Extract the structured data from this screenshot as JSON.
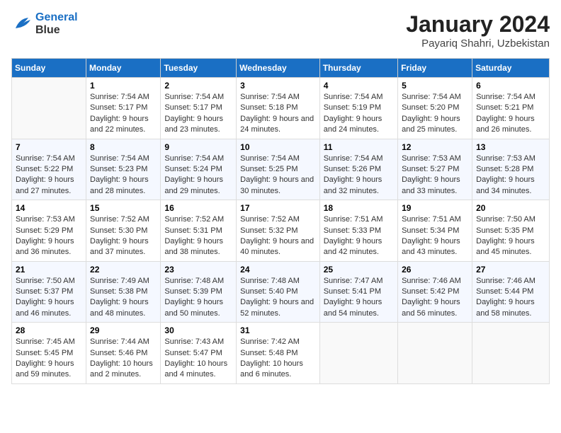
{
  "header": {
    "logo_line1": "General",
    "logo_line2": "Blue",
    "month": "January 2024",
    "location": "Payariq Shahri, Uzbekistan"
  },
  "days_of_week": [
    "Sunday",
    "Monday",
    "Tuesday",
    "Wednesday",
    "Thursday",
    "Friday",
    "Saturday"
  ],
  "weeks": [
    [
      {
        "num": "",
        "sunrise": "",
        "sunset": "",
        "daylight": ""
      },
      {
        "num": "1",
        "sunrise": "Sunrise: 7:54 AM",
        "sunset": "Sunset: 5:17 PM",
        "daylight": "Daylight: 9 hours and 22 minutes."
      },
      {
        "num": "2",
        "sunrise": "Sunrise: 7:54 AM",
        "sunset": "Sunset: 5:17 PM",
        "daylight": "Daylight: 9 hours and 23 minutes."
      },
      {
        "num": "3",
        "sunrise": "Sunrise: 7:54 AM",
        "sunset": "Sunset: 5:18 PM",
        "daylight": "Daylight: 9 hours and 24 minutes."
      },
      {
        "num": "4",
        "sunrise": "Sunrise: 7:54 AM",
        "sunset": "Sunset: 5:19 PM",
        "daylight": "Daylight: 9 hours and 24 minutes."
      },
      {
        "num": "5",
        "sunrise": "Sunrise: 7:54 AM",
        "sunset": "Sunset: 5:20 PM",
        "daylight": "Daylight: 9 hours and 25 minutes."
      },
      {
        "num": "6",
        "sunrise": "Sunrise: 7:54 AM",
        "sunset": "Sunset: 5:21 PM",
        "daylight": "Daylight: 9 hours and 26 minutes."
      }
    ],
    [
      {
        "num": "7",
        "sunrise": "Sunrise: 7:54 AM",
        "sunset": "Sunset: 5:22 PM",
        "daylight": "Daylight: 9 hours and 27 minutes."
      },
      {
        "num": "8",
        "sunrise": "Sunrise: 7:54 AM",
        "sunset": "Sunset: 5:23 PM",
        "daylight": "Daylight: 9 hours and 28 minutes."
      },
      {
        "num": "9",
        "sunrise": "Sunrise: 7:54 AM",
        "sunset": "Sunset: 5:24 PM",
        "daylight": "Daylight: 9 hours and 29 minutes."
      },
      {
        "num": "10",
        "sunrise": "Sunrise: 7:54 AM",
        "sunset": "Sunset: 5:25 PM",
        "daylight": "Daylight: 9 hours and 30 minutes."
      },
      {
        "num": "11",
        "sunrise": "Sunrise: 7:54 AM",
        "sunset": "Sunset: 5:26 PM",
        "daylight": "Daylight: 9 hours and 32 minutes."
      },
      {
        "num": "12",
        "sunrise": "Sunrise: 7:53 AM",
        "sunset": "Sunset: 5:27 PM",
        "daylight": "Daylight: 9 hours and 33 minutes."
      },
      {
        "num": "13",
        "sunrise": "Sunrise: 7:53 AM",
        "sunset": "Sunset: 5:28 PM",
        "daylight": "Daylight: 9 hours and 34 minutes."
      }
    ],
    [
      {
        "num": "14",
        "sunrise": "Sunrise: 7:53 AM",
        "sunset": "Sunset: 5:29 PM",
        "daylight": "Daylight: 9 hours and 36 minutes."
      },
      {
        "num": "15",
        "sunrise": "Sunrise: 7:52 AM",
        "sunset": "Sunset: 5:30 PM",
        "daylight": "Daylight: 9 hours and 37 minutes."
      },
      {
        "num": "16",
        "sunrise": "Sunrise: 7:52 AM",
        "sunset": "Sunset: 5:31 PM",
        "daylight": "Daylight: 9 hours and 38 minutes."
      },
      {
        "num": "17",
        "sunrise": "Sunrise: 7:52 AM",
        "sunset": "Sunset: 5:32 PM",
        "daylight": "Daylight: 9 hours and 40 minutes."
      },
      {
        "num": "18",
        "sunrise": "Sunrise: 7:51 AM",
        "sunset": "Sunset: 5:33 PM",
        "daylight": "Daylight: 9 hours and 42 minutes."
      },
      {
        "num": "19",
        "sunrise": "Sunrise: 7:51 AM",
        "sunset": "Sunset: 5:34 PM",
        "daylight": "Daylight: 9 hours and 43 minutes."
      },
      {
        "num": "20",
        "sunrise": "Sunrise: 7:50 AM",
        "sunset": "Sunset: 5:35 PM",
        "daylight": "Daylight: 9 hours and 45 minutes."
      }
    ],
    [
      {
        "num": "21",
        "sunrise": "Sunrise: 7:50 AM",
        "sunset": "Sunset: 5:37 PM",
        "daylight": "Daylight: 9 hours and 46 minutes."
      },
      {
        "num": "22",
        "sunrise": "Sunrise: 7:49 AM",
        "sunset": "Sunset: 5:38 PM",
        "daylight": "Daylight: 9 hours and 48 minutes."
      },
      {
        "num": "23",
        "sunrise": "Sunrise: 7:48 AM",
        "sunset": "Sunset: 5:39 PM",
        "daylight": "Daylight: 9 hours and 50 minutes."
      },
      {
        "num": "24",
        "sunrise": "Sunrise: 7:48 AM",
        "sunset": "Sunset: 5:40 PM",
        "daylight": "Daylight: 9 hours and 52 minutes."
      },
      {
        "num": "25",
        "sunrise": "Sunrise: 7:47 AM",
        "sunset": "Sunset: 5:41 PM",
        "daylight": "Daylight: 9 hours and 54 minutes."
      },
      {
        "num": "26",
        "sunrise": "Sunrise: 7:46 AM",
        "sunset": "Sunset: 5:42 PM",
        "daylight": "Daylight: 9 hours and 56 minutes."
      },
      {
        "num": "27",
        "sunrise": "Sunrise: 7:46 AM",
        "sunset": "Sunset: 5:44 PM",
        "daylight": "Daylight: 9 hours and 58 minutes."
      }
    ],
    [
      {
        "num": "28",
        "sunrise": "Sunrise: 7:45 AM",
        "sunset": "Sunset: 5:45 PM",
        "daylight": "Daylight: 9 hours and 59 minutes."
      },
      {
        "num": "29",
        "sunrise": "Sunrise: 7:44 AM",
        "sunset": "Sunset: 5:46 PM",
        "daylight": "Daylight: 10 hours and 2 minutes."
      },
      {
        "num": "30",
        "sunrise": "Sunrise: 7:43 AM",
        "sunset": "Sunset: 5:47 PM",
        "daylight": "Daylight: 10 hours and 4 minutes."
      },
      {
        "num": "31",
        "sunrise": "Sunrise: 7:42 AM",
        "sunset": "Sunset: 5:48 PM",
        "daylight": "Daylight: 10 hours and 6 minutes."
      },
      {
        "num": "",
        "sunrise": "",
        "sunset": "",
        "daylight": ""
      },
      {
        "num": "",
        "sunrise": "",
        "sunset": "",
        "daylight": ""
      },
      {
        "num": "",
        "sunrise": "",
        "sunset": "",
        "daylight": ""
      }
    ]
  ]
}
